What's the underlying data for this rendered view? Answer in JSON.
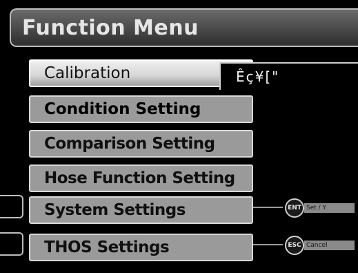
{
  "header": {
    "title": "Function Menu"
  },
  "menu": {
    "items": [
      {
        "label": "Calibration"
      },
      {
        "label": "Condition Setting"
      },
      {
        "label": "Comparison Setting"
      },
      {
        "label": "Hose Function Setting"
      },
      {
        "label": "System Settings"
      },
      {
        "label": "THOS Settings"
      }
    ]
  },
  "popup": {
    "text": "Êç¥[\""
  },
  "keys": {
    "enter": {
      "badge": "ENT",
      "label": "Set / Y"
    },
    "escape": {
      "badge": "ESC",
      "label": "Cancel"
    }
  },
  "colors": {
    "background": "#000000",
    "item_bg": "#9a9a9a",
    "selected_bg": "#e0e0e0"
  }
}
